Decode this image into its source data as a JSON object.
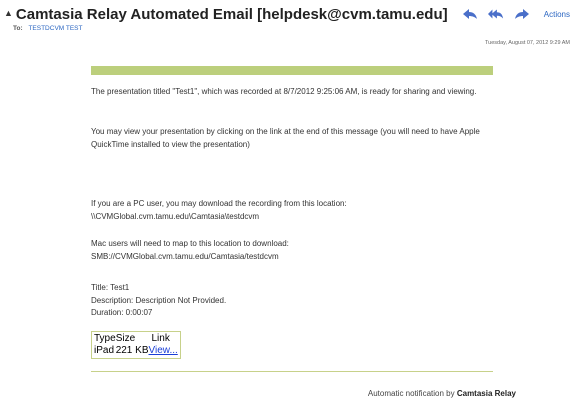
{
  "header": {
    "subject": "Camtasia Relay Automated Email [helpdesk@cvm.tamu.edu]",
    "to_label": "To:",
    "to_name": "TESTDCVM TEST",
    "actions_label": "Actions",
    "date": "Tuesday, August 07, 2012 9:29 AM",
    "icons": [
      "reply-icon",
      "reply-all-icon",
      "forward-icon"
    ],
    "accent_color": "#2b66c2"
  },
  "body": {
    "bar_color": "#bccf7c",
    "p1": "The presentation titled \"Test1\", which was recorded at 8/7/2012 9:25:06 AM, is ready for sharing and viewing.",
    "p2": "You may view your presentation by clicking on the link at the end of this message (you will need to have Apple QuickTime installed to view the presentation)",
    "p3_line1": "If you are a PC user, you may download the recording from this location:",
    "p3_line2": "\\\\CVMGlobal.cvm.tamu.edu\\Camtasia\\testdcvm",
    "p4_line1": "Mac users will need to map to this location to download:",
    "p4_line2": "SMB://CVMGlobal.cvm.tamu.edu/Camtasia/testdcvm",
    "title_line": "Title: Test1",
    "description_line": "Description: Description Not Provided.",
    "duration_line": "Duration: 0:00:07",
    "files": {
      "headers": [
        "Type",
        "Size",
        "Link"
      ],
      "row": {
        "type": "iPad",
        "size": "221 KB",
        "link": "View..."
      }
    },
    "footer_prefix": "Automatic notification by",
    "footer_brand": "Camtasia Relay"
  }
}
